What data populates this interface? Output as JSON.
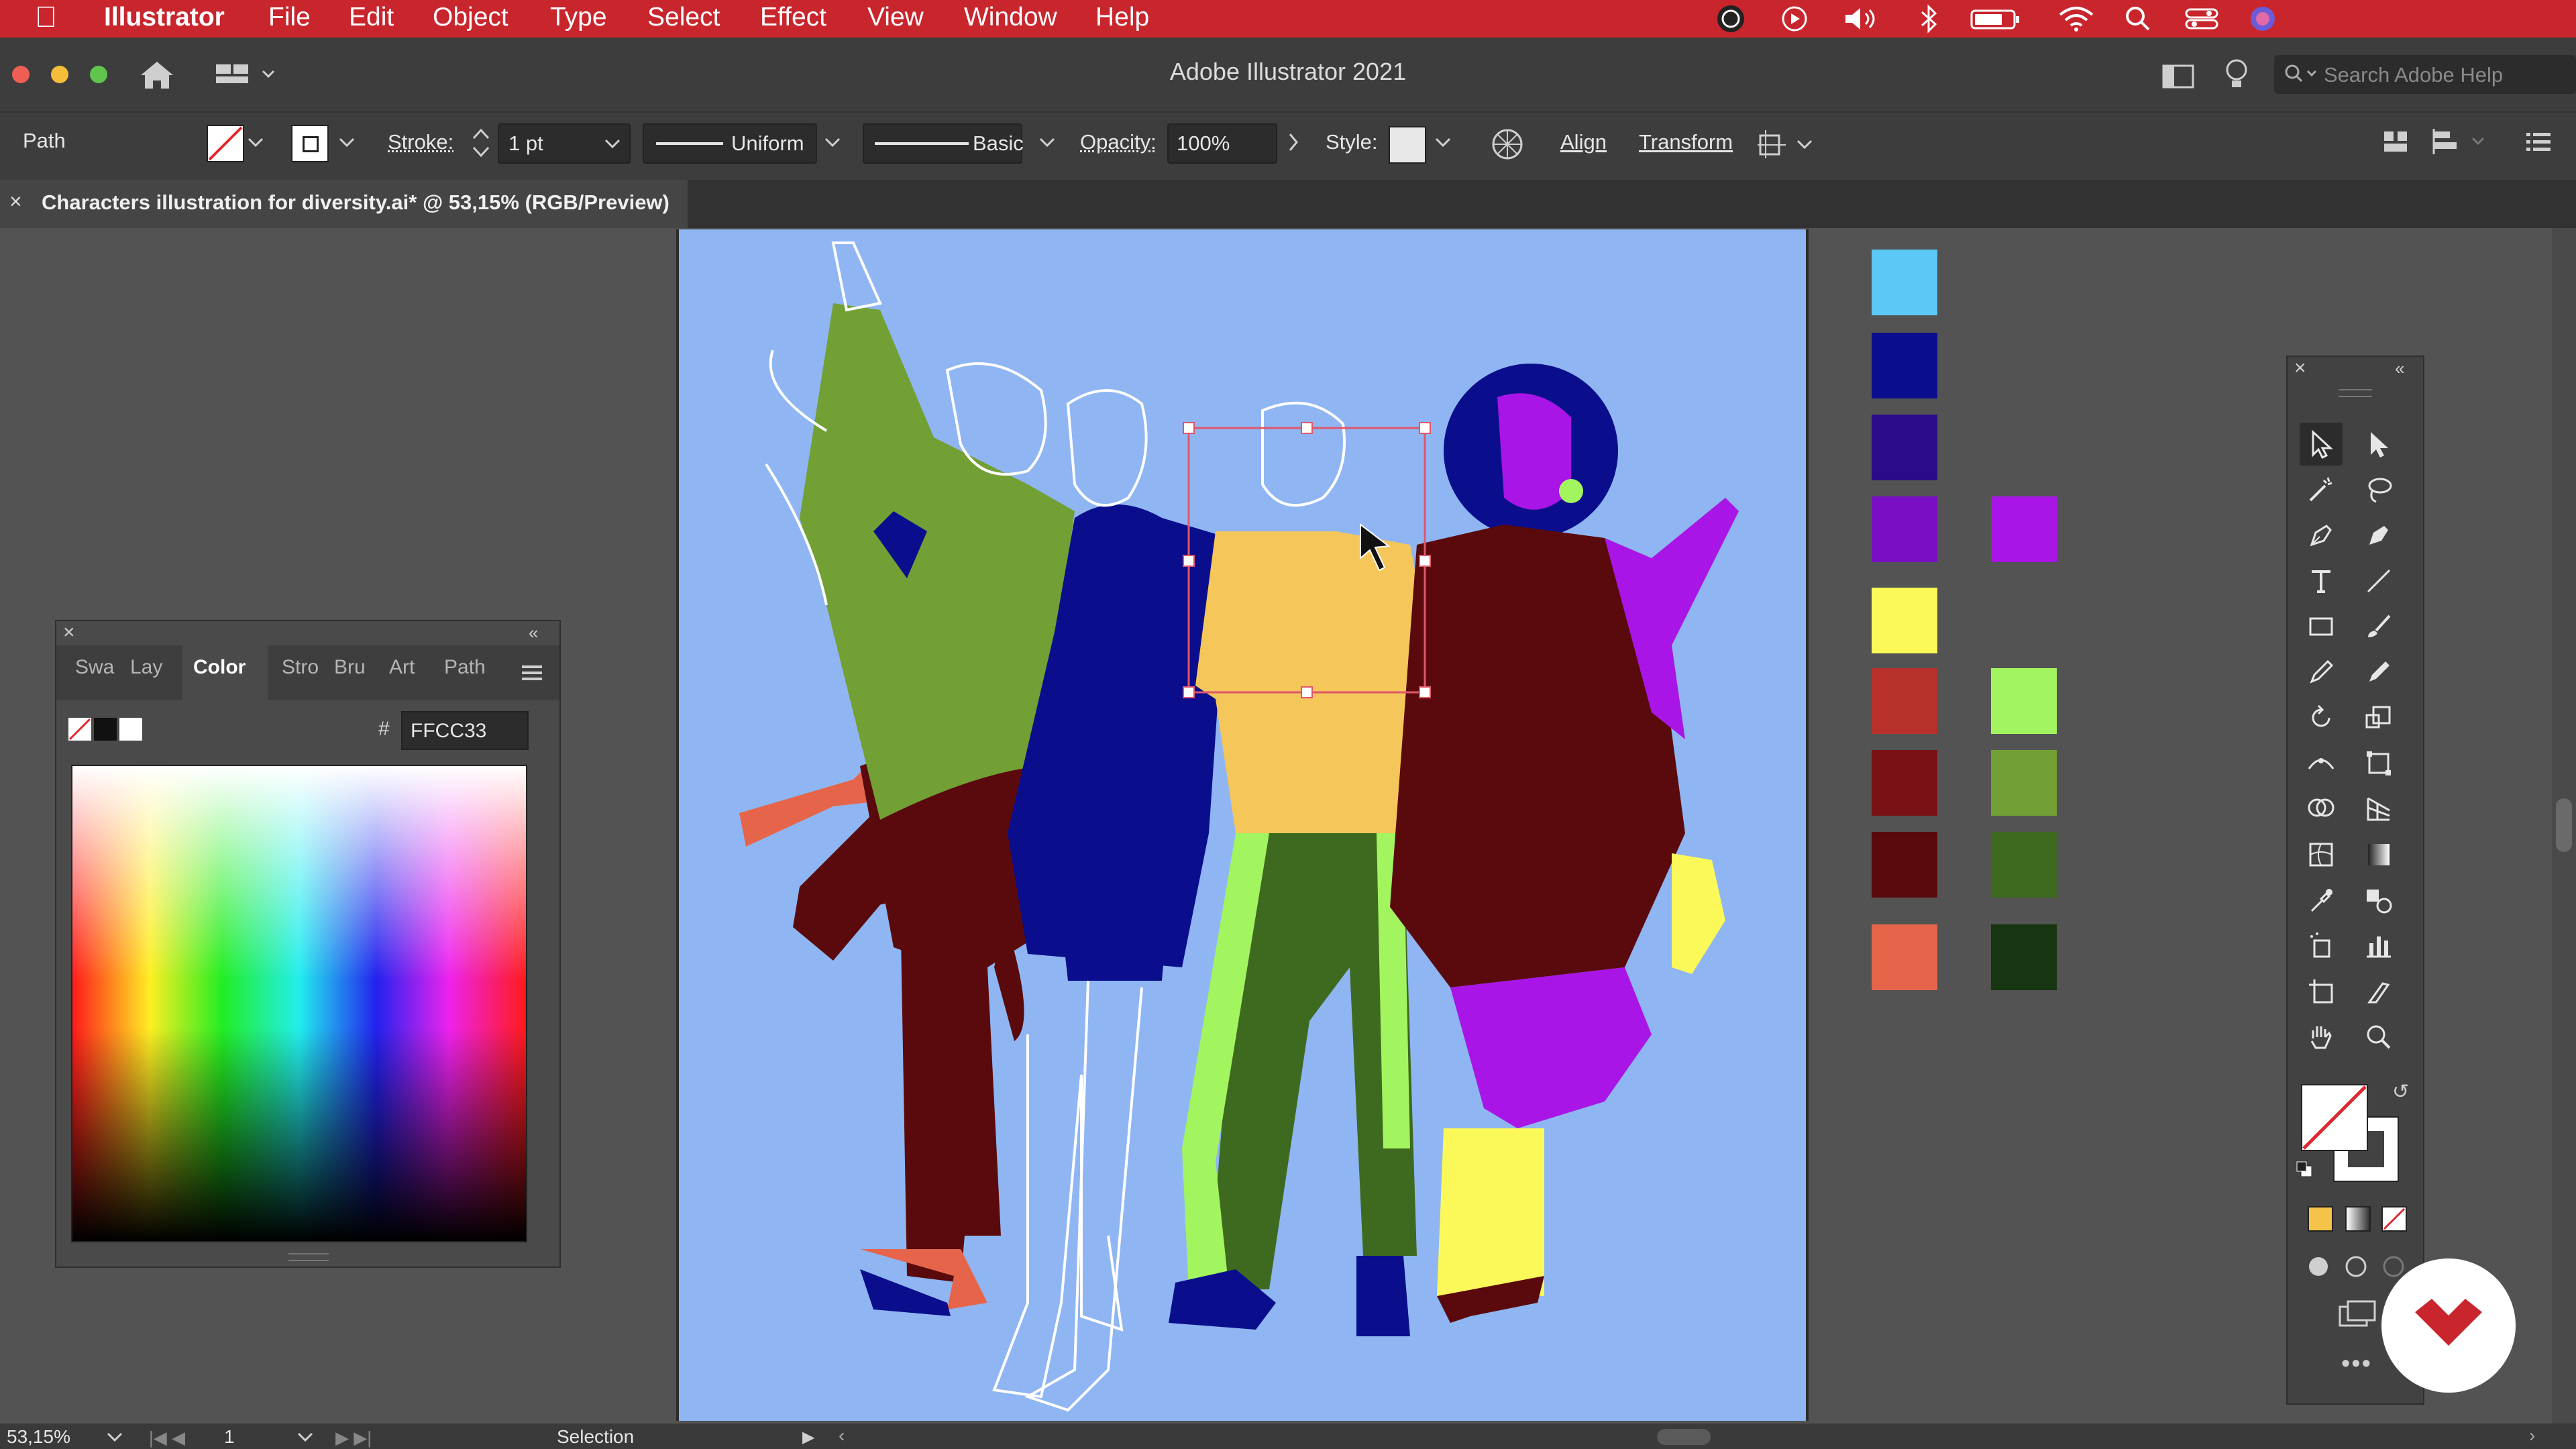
{
  "menubar": {
    "app_name": "Illustrator",
    "items": [
      "File",
      "Edit",
      "Object",
      "Type",
      "Select",
      "Effect",
      "View",
      "Window",
      "Help"
    ]
  },
  "window": {
    "title": "Adobe Illustrator 2021",
    "search_placeholder": "Search Adobe Help"
  },
  "control_bar": {
    "selection_type": "Path",
    "stroke_label": "Stroke:",
    "stroke_weight": "1 pt",
    "profile_label": "Uniform",
    "brush_label": "Basic",
    "opacity_label": "Opacity:",
    "opacity_value": "100%",
    "style_label": "Style:",
    "align_label": "Align",
    "transform_label": "Transform"
  },
  "document_tab": {
    "title": "Characters illustration for diversity.ai* @ 53,15% (RGB/Preview)"
  },
  "color_panel": {
    "tabs": [
      "Swa",
      "Lay",
      "Color",
      "Stro",
      "Bru",
      "Art",
      "Path"
    ],
    "active_tab": "Color",
    "hex_label": "#",
    "hex_value": "FFCC33"
  },
  "swatches": {
    "left_column": [
      "#5bc8f5",
      "#0b0e8c",
      "#2a0c8a",
      "#7a0ec4",
      "#fbf95a",
      "#b8312a",
      "#7a1215",
      "#5a0a0c",
      "#e6654a"
    ],
    "right_column": [
      "#a815e6",
      "#a3f560",
      "#72a034",
      "#3e6a1f",
      "#173510"
    ]
  },
  "colors": {
    "menubar": "#c8252d",
    "artboard": "#8fb6f2",
    "fill_hex": "#FFCC33"
  },
  "status_bar": {
    "zoom": "53,15%",
    "artboard_number": "1",
    "tool_name": "Selection"
  }
}
